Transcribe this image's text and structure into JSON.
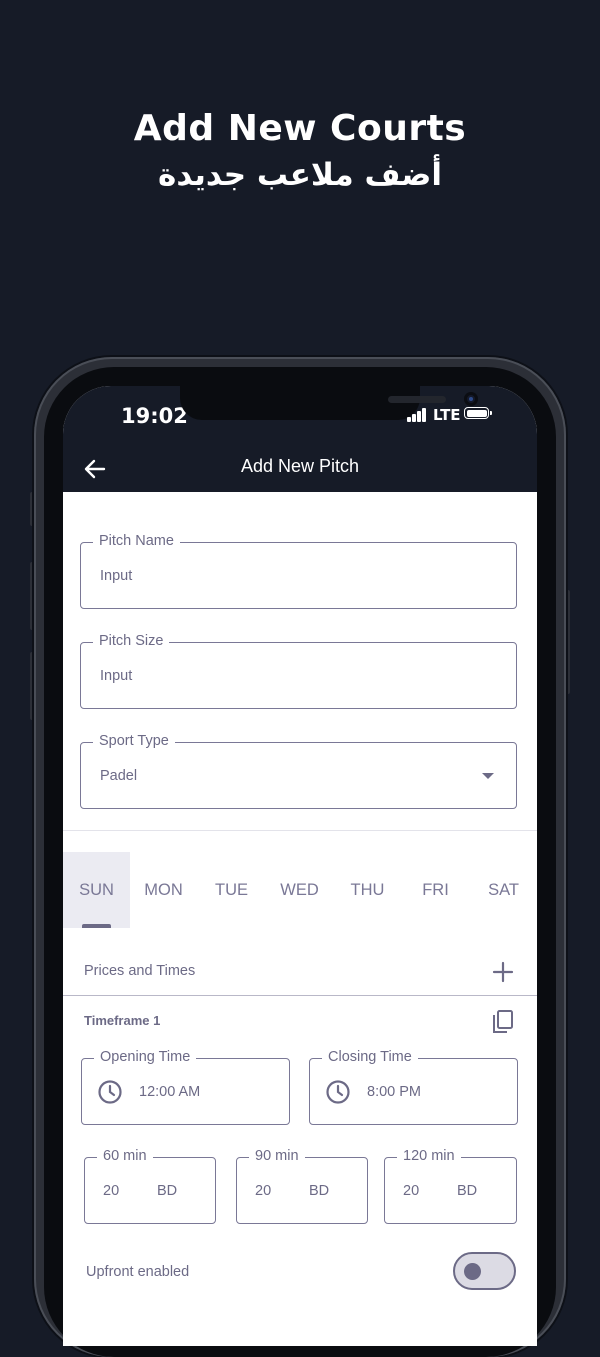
{
  "hero": {
    "title": "Add New Courts",
    "subtitle_ar": "أضف ملاعب جديدة"
  },
  "status_bar": {
    "time": "19:02",
    "network": "LTE"
  },
  "app_bar": {
    "back_icon": "arrow-left-icon",
    "title": "Add New Pitch"
  },
  "form": {
    "pitch_name": {
      "label": "Pitch Name",
      "placeholder": "Input"
    },
    "pitch_size": {
      "label": "Pitch Size",
      "placeholder": "Input"
    },
    "sport_type": {
      "label": "Sport Type",
      "value": "Padel"
    }
  },
  "days": {
    "selected": "SUN",
    "items": [
      "SUN",
      "MON",
      "TUE",
      "WED",
      "THU",
      "FRI",
      "SAT"
    ]
  },
  "prices_and_times": {
    "label": "Prices and Times",
    "add_icon": "plus-icon"
  },
  "timeframe": {
    "label": "Timeframe 1",
    "copy_icon": "copy-icon",
    "opening": {
      "label": "Opening Time",
      "value": "12:00 AM"
    },
    "closing": {
      "label": "Closing Time",
      "value": "8:00 PM"
    },
    "prices": [
      {
        "label": "60 min",
        "value": "20",
        "unit": "BD"
      },
      {
        "label": "90 min",
        "value": "20",
        "unit": "BD"
      },
      {
        "label": "120 min",
        "value": "20",
        "unit": "BD"
      }
    ]
  },
  "upfront": {
    "label": "Upfront enabled",
    "enabled": false
  },
  "colors": {
    "background": "#161b27",
    "accent": "#6c6a86",
    "surface": "#ffffff",
    "tab_active_bg": "#ebebf2"
  }
}
